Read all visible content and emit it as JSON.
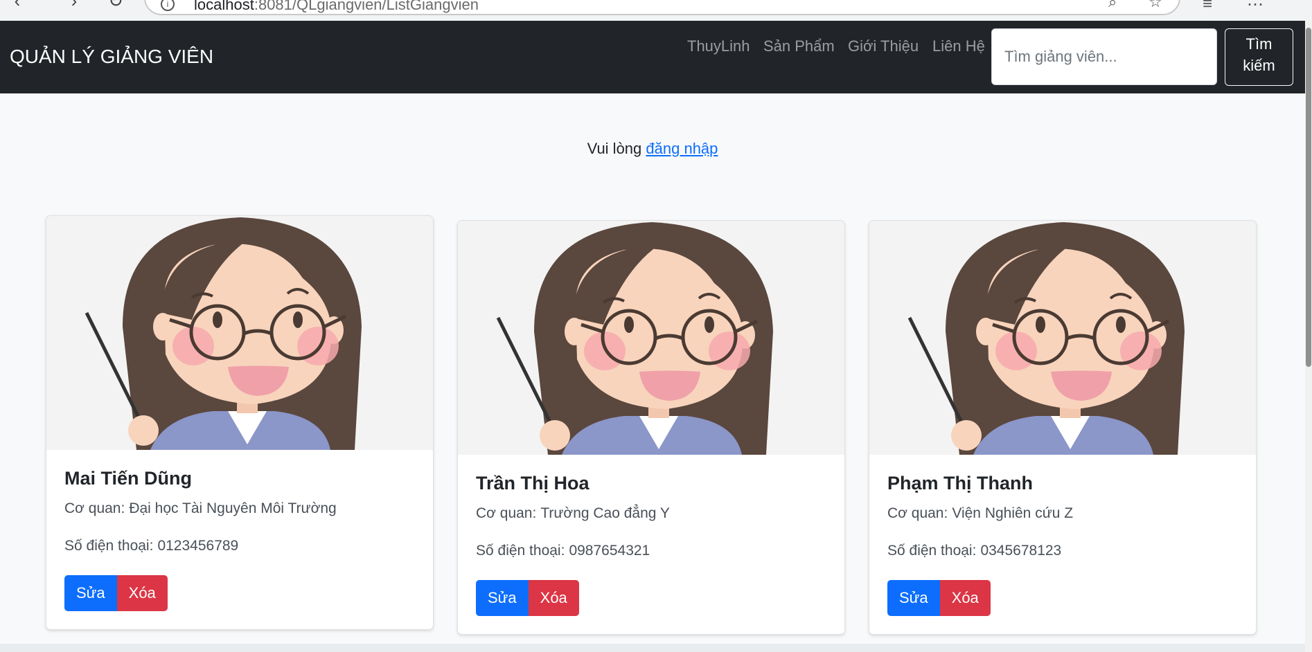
{
  "browser": {
    "url_host": "localhost",
    "url_rest": ":8081/QLgiangvien/ListGiangvien"
  },
  "navbar": {
    "brand": "QUẢN LÝ GIẢNG VIÊN",
    "links": [
      "ThuyLinh",
      "Sản Phẩm",
      "Giới Thiệu",
      "Liên Hệ"
    ],
    "search_placeholder": "Tìm giảng viên...",
    "search_button_line1": "Tìm",
    "search_button_line2": "kiếm"
  },
  "login_prompt": {
    "text": "Vui lòng",
    "link": "đăng nhập"
  },
  "labels": {
    "agency": "Cơ quan:",
    "phone": "Số điện thoại:",
    "edit": "Sửa",
    "delete": "Xóa"
  },
  "lecturers": [
    {
      "name": "Mai Tiến Dũng",
      "agency": "Đại học Tài Nguyên Môi Trường",
      "phone": "0123456789"
    },
    {
      "name": "Trần Thị Hoa",
      "agency": "Trường Cao đẳng Y",
      "phone": "0987654321"
    },
    {
      "name": "Phạm Thị Thanh",
      "agency": "Viện Nghiên cứu Z",
      "phone": "0345678123"
    }
  ],
  "colors": {
    "navbar_bg": "#212529",
    "primary": "#0d6efd",
    "danger": "#dc3545",
    "page_bg": "#f8f9fa"
  }
}
